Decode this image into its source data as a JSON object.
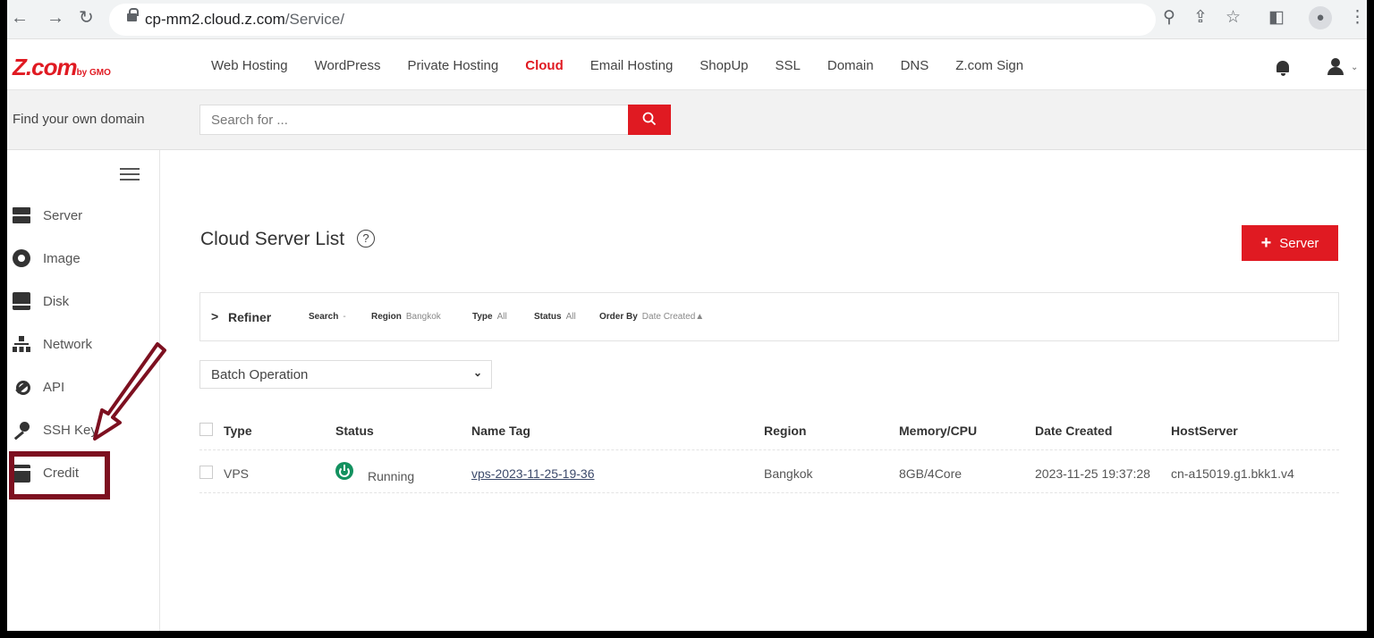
{
  "browser": {
    "url_host": "cp-mm2.cloud.z.com",
    "url_path": "/Service/",
    "icons": [
      "back-icon",
      "forward-icon",
      "reload-icon",
      "lock-icon",
      "zoom-icon",
      "share-icon",
      "star-icon",
      "sidepanel-icon",
      "profile-icon",
      "menu-icon"
    ]
  },
  "header": {
    "logo_main": "Z.com",
    "logo_sub": "by GMO",
    "nav": [
      "Web Hosting",
      "WordPress",
      "Private Hosting",
      "Cloud",
      "Email Hosting",
      "ShopUp",
      "SSL",
      "Domain",
      "DNS",
      "Z.com Sign"
    ],
    "active_nav": "Cloud"
  },
  "search": {
    "label": "Find your own domain",
    "placeholder": "Search for ..."
  },
  "sidebar": {
    "items": [
      {
        "label": "Server",
        "icon": "server-icon"
      },
      {
        "label": "Image",
        "icon": "image-icon"
      },
      {
        "label": "Disk",
        "icon": "disk-icon"
      },
      {
        "label": "Network",
        "icon": "network-icon"
      },
      {
        "label": "API",
        "icon": "api-icon"
      },
      {
        "label": "SSH Key",
        "icon": "key-icon"
      },
      {
        "label": "Credit",
        "icon": "credit-card-icon"
      }
    ]
  },
  "main": {
    "title": "Cloud Server List",
    "help": "?",
    "add_button": "Server",
    "refiner": {
      "label": "Refiner",
      "search_key": "Search",
      "search_val": "-",
      "region_key": "Region",
      "region_val": "Bangkok",
      "type_key": "Type",
      "type_val": "All",
      "status_key": "Status",
      "status_val": "All",
      "order_key": "Order By",
      "order_val": "Date Created▲"
    },
    "batch": "Batch Operation",
    "table": {
      "headers": [
        "Type",
        "Status",
        "Name Tag",
        "Region",
        "Memory/CPU",
        "Date Created",
        "HostServer"
      ],
      "rows": [
        {
          "type": "VPS",
          "status": "Running",
          "name_tag": "vps-2023-11-25-19-36",
          "region": "Bangkok",
          "memory_cpu": "8GB/4Core",
          "date_created": "2023-11-25 19:37:28",
          "host_server": "cn-a15019.g1.bkk1.v4"
        }
      ]
    }
  },
  "colors": {
    "brand": "#e01a22",
    "status_running": "#13915f",
    "annotation": "#7d1020"
  }
}
